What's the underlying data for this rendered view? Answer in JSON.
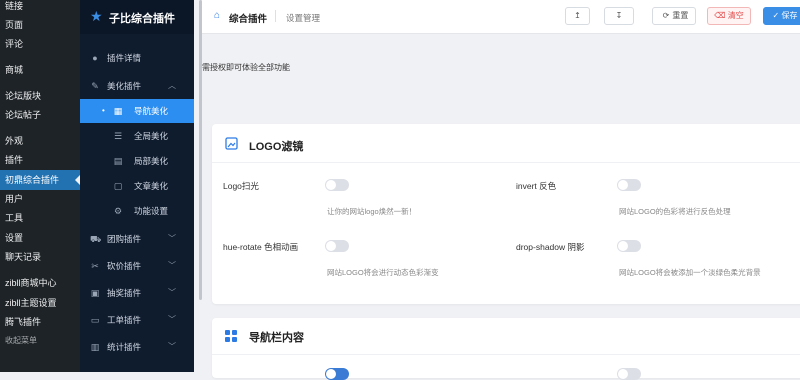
{
  "wp_menu": [
    {
      "label": "链接",
      "active": false
    },
    {
      "label": "页面",
      "active": false
    },
    {
      "label": "评论",
      "active": false
    },
    {
      "label": "商城",
      "active": false
    },
    {
      "label": "论坛版块",
      "active": false
    },
    {
      "label": "论坛帖子",
      "active": false
    },
    {
      "label": "外观",
      "active": false
    },
    {
      "label": "插件",
      "active": false
    },
    {
      "label": "初鼎综合插件",
      "active": true
    },
    {
      "label": "用户",
      "active": false
    },
    {
      "label": "工具",
      "active": false
    },
    {
      "label": "设置",
      "active": false
    },
    {
      "label": "聊天记录",
      "active": false
    },
    {
      "label": "zibll商城中心",
      "active": false
    },
    {
      "label": "zibll主题设置",
      "active": false
    },
    {
      "label": "腾飞插件",
      "active": false
    },
    {
      "label": "收起菜单",
      "active": false
    }
  ],
  "plugin_sidebar": {
    "title": "子比综合插件",
    "items": [
      {
        "label": "插件详情",
        "icon": "info-icon",
        "chevron": ""
      },
      {
        "label": "美化插件",
        "icon": "magic-wand-icon",
        "chevron": "︿"
      },
      {
        "label": "导航美化",
        "icon": "grid-icon",
        "sub": true,
        "active": true
      },
      {
        "label": "全局美化",
        "icon": "sliders-icon",
        "sub": true
      },
      {
        "label": "局部美化",
        "icon": "table-icon",
        "sub": true
      },
      {
        "label": "文章美化",
        "icon": "document-icon",
        "sub": true
      },
      {
        "label": "功能设置",
        "icon": "gear-icon",
        "sub": true
      },
      {
        "label": "团购插件",
        "icon": "cart-icon",
        "chevron": "﹀"
      },
      {
        "label": "砍价插件",
        "icon": "scissors-icon",
        "chevron": "﹀"
      },
      {
        "label": "抽奖插件",
        "icon": "gift-icon",
        "chevron": "﹀"
      },
      {
        "label": "工单插件",
        "icon": "ticket-icon",
        "chevron": "﹀"
      },
      {
        "label": "统计插件",
        "icon": "chart-icon",
        "chevron": "﹀"
      }
    ]
  },
  "header": {
    "crumb1": "综合插件",
    "crumb2": "设置管理",
    "upload_icon": "↥",
    "download_icon": "↧",
    "reset_label": "重置",
    "clear_label": "清空",
    "save_label": "保存"
  },
  "notice": "需授权即可体验全部功能",
  "logo_card": {
    "title": "LOGO滤镜",
    "fields": [
      {
        "label": "Logo扫光",
        "desc": "让你的网站logo焕然一新！"
      },
      {
        "label": "invert 反色",
        "desc": "网站LOGO的色彩将进行反色处理"
      },
      {
        "label": "hue-rotate 色相动画",
        "desc": "网站LOGO将会进行动态色彩渐变"
      },
      {
        "label": "drop-shadow 阴影",
        "desc": "网站LOGO将会被添加一个淡绿色柔光背景"
      }
    ]
  },
  "nav_card": {
    "title": "导航栏内容"
  },
  "colors": {
    "wp_bg": "#1d2327",
    "plugin_bg": "#0f1c2e",
    "accent": "#2c8ef0",
    "danger": "#e24b4b"
  }
}
